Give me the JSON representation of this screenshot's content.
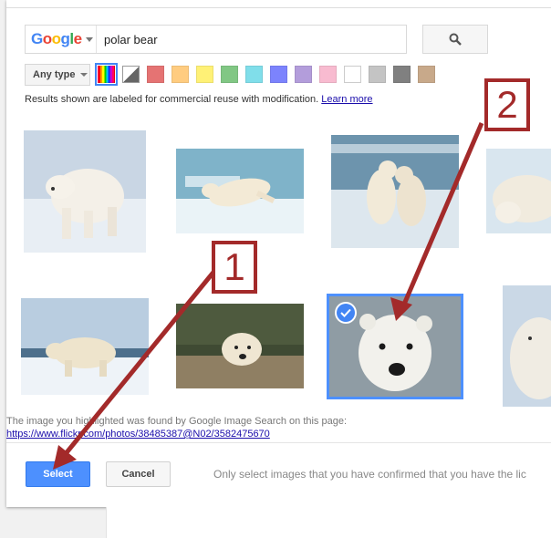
{
  "search": {
    "brand_letters": [
      "G",
      "o",
      "o",
      "g",
      "l",
      "e"
    ],
    "query": "polar bear",
    "search_icon": "search-icon"
  },
  "filters": {
    "type_label": "Any type",
    "colors": [
      "full-color",
      "black-and-white",
      "#e57373",
      "#ffcc80",
      "#fff176",
      "#81c784",
      "#80deea",
      "#7c83fd",
      "#b39ddb",
      "#f8bbd0",
      "#ffffff",
      "#c4c4c4",
      "#808080",
      "#c8a98a"
    ]
  },
  "notice": {
    "text": "Results shown are labeled for commercial reuse with modification.",
    "link": "Learn more"
  },
  "results": {
    "selected_index": 6,
    "selected_icon": "check-icon"
  },
  "source": {
    "text": "The image you highlighted was found by Google Image Search on this page:",
    "url": "https://www.flickr.com/photos/38485387@N02/3582475670"
  },
  "actions": {
    "select_label": "Select",
    "cancel_label": "Cancel",
    "footnote": "Only select images that you have confirmed that you have the lic"
  },
  "annotations": {
    "callout_1": "1",
    "callout_2": "2",
    "color": "#a32a2a"
  }
}
